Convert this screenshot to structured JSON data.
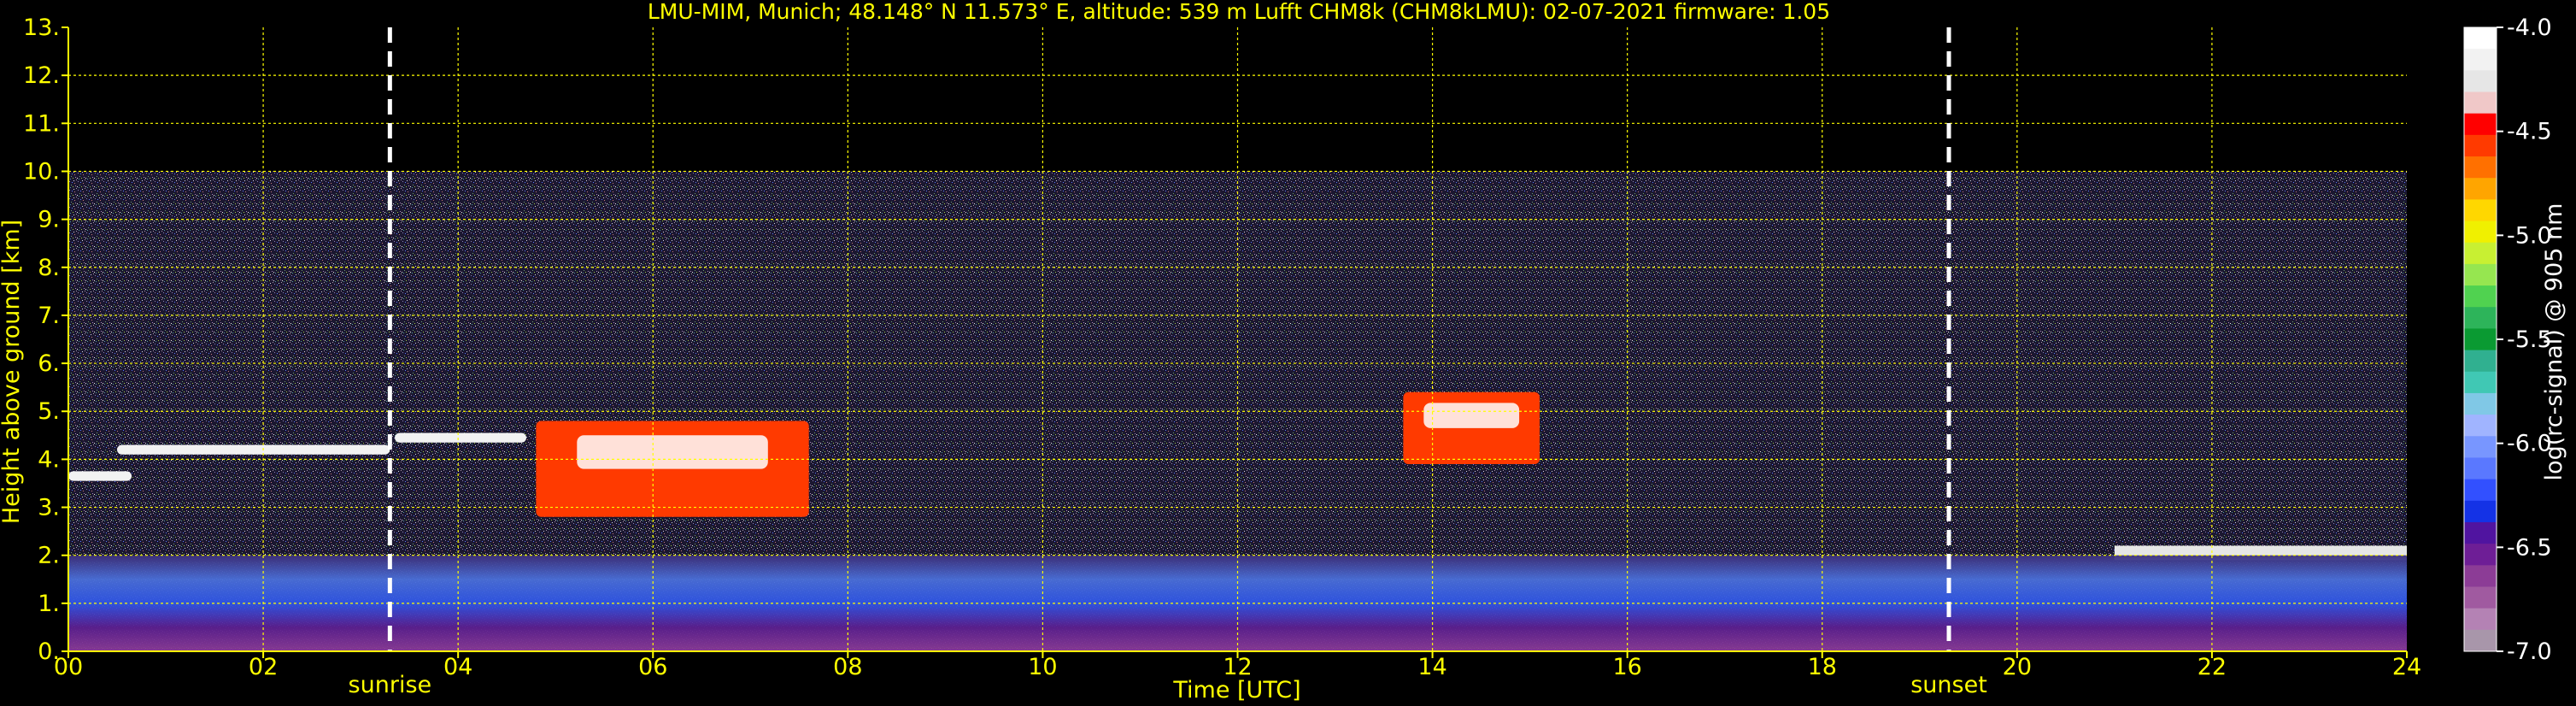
{
  "title": "LMU-MIM, Munich; 48.148° N 11.573° E, altitude: 539 m    Lufft CHM8k (CHM8kLMU): 02-07-2021    firmware: 1.05",
  "colors": {
    "text": "#ffff00",
    "grid": "#ffff00",
    "background": "#000000",
    "sun_lines": "#ffffff"
  },
  "chart_data": {
    "type": "heatmap",
    "xlabel": "Time [UTC]",
    "ylabel": "Height above ground [km]",
    "xlim": [
      0,
      24
    ],
    "ylim": [
      0,
      13
    ],
    "x_ticks": [
      0,
      2,
      4,
      6,
      8,
      10,
      12,
      14,
      16,
      18,
      20,
      22,
      24
    ],
    "x_tick_labels": [
      "00",
      "02",
      "04",
      "06",
      "08",
      "10",
      "12",
      "14",
      "16",
      "18",
      "20",
      "22",
      "24"
    ],
    "y_ticks": [
      0,
      1,
      2,
      3,
      4,
      5,
      6,
      7,
      8,
      9,
      10,
      11,
      12,
      13
    ],
    "y_tick_labels": [
      "0.",
      "1.",
      "2.",
      "3.",
      "4.",
      "5.",
      "6.",
      "7.",
      "8.",
      "9.",
      "10.",
      "11.",
      "12.",
      "13."
    ],
    "grid": true,
    "measurement_top_km": 10,
    "colorbar": {
      "label": "log(rc-signal) @ 905 nm",
      "range": [
        -7.0,
        -4.0
      ],
      "ticks": [
        -4.0,
        -4.5,
        -5.0,
        -5.5,
        -6.0,
        -6.5,
        -7.0
      ],
      "tick_labels": [
        "-4.0",
        "-4.5",
        "-5.0",
        "-5.5",
        "-6.0",
        "-6.5",
        "-7.0"
      ],
      "colors": [
        "#ffffff",
        "#f2f2f2",
        "#e6e6e6",
        "#f0c8c8",
        "#ff0000",
        "#ff3a00",
        "#ff7000",
        "#ffa500",
        "#ffd700",
        "#f0f000",
        "#c8f032",
        "#96e650",
        "#50d250",
        "#2db45a",
        "#0a9a32",
        "#30b090",
        "#40c8b4",
        "#80c8e6",
        "#a0b4ff",
        "#7896ff",
        "#5a78ff",
        "#3250ff",
        "#1432e6",
        "#5014a0",
        "#6e1e96",
        "#8c3c96",
        "#a05aa0",
        "#b482b4",
        "#a896aa"
      ]
    },
    "markers": [
      {
        "label": "sunrise",
        "x": 3.3
      },
      {
        "label": "sunset",
        "x": 19.3
      }
    ],
    "layers": [
      {
        "kind": "cloud",
        "x": [
          0.0,
          0.65
        ],
        "y": [
          3.55,
          3.75
        ]
      },
      {
        "kind": "cloud",
        "x": [
          0.5,
          3.3
        ],
        "y": [
          4.1,
          4.3
        ]
      },
      {
        "kind": "cloud",
        "x": [
          3.35,
          4.7
        ],
        "y": [
          4.35,
          4.55
        ]
      },
      {
        "kind": "cloud",
        "x": [
          4.8,
          7.6
        ],
        "y": [
          2.8,
          4.8
        ]
      },
      {
        "kind": "cloud",
        "x": [
          13.7,
          15.1
        ],
        "y": [
          3.9,
          5.4
        ]
      },
      {
        "kind": "boundary_layer",
        "x": [
          21.0,
          24.0
        ],
        "y": [
          1.9,
          2.2
        ]
      },
      {
        "kind": "aerosol",
        "x": [
          0.0,
          24.0
        ],
        "y": [
          0.0,
          2.0
        ]
      }
    ]
  }
}
